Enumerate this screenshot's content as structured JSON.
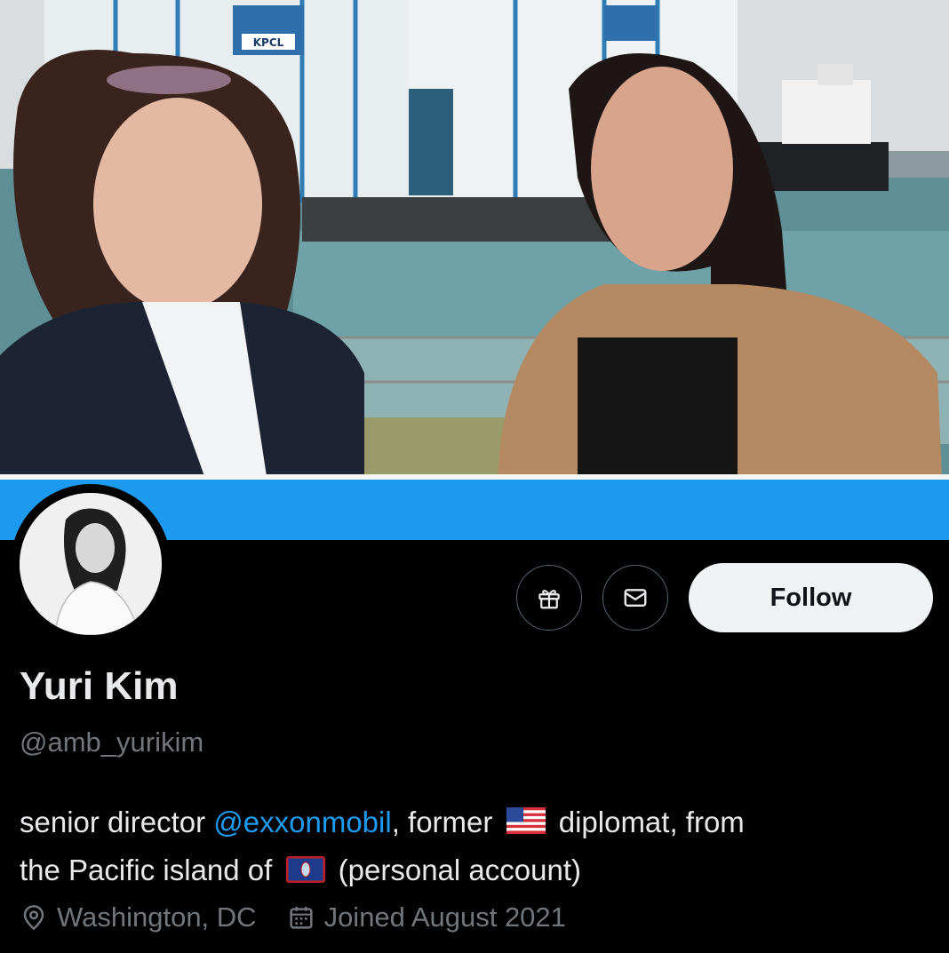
{
  "photo": {
    "sign_text": "KPCL"
  },
  "profile": {
    "name": "Yuri Kim",
    "handle": "@amb_yurikim",
    "follow_label": "Follow",
    "bio": {
      "part1": "senior director ",
      "mention": "@exxonmobil",
      "part2": ", former ",
      "flag1": "us-flag",
      "part3": " diplomat, from",
      "part4": "the Pacific island of ",
      "flag2": "guam-flag",
      "part5": " (personal account)"
    },
    "location": "Washington, DC",
    "joined": "Joined August 2021"
  },
  "icons": {
    "gift": "gift-icon",
    "message": "envelope-icon",
    "location": "location-pin-icon",
    "calendar": "calendar-icon"
  },
  "colors": {
    "accent": "#1d9bf0",
    "background": "#000000",
    "text_primary": "#e7e9ea",
    "text_secondary": "#71767b",
    "follow_bg": "#eff3f4"
  }
}
